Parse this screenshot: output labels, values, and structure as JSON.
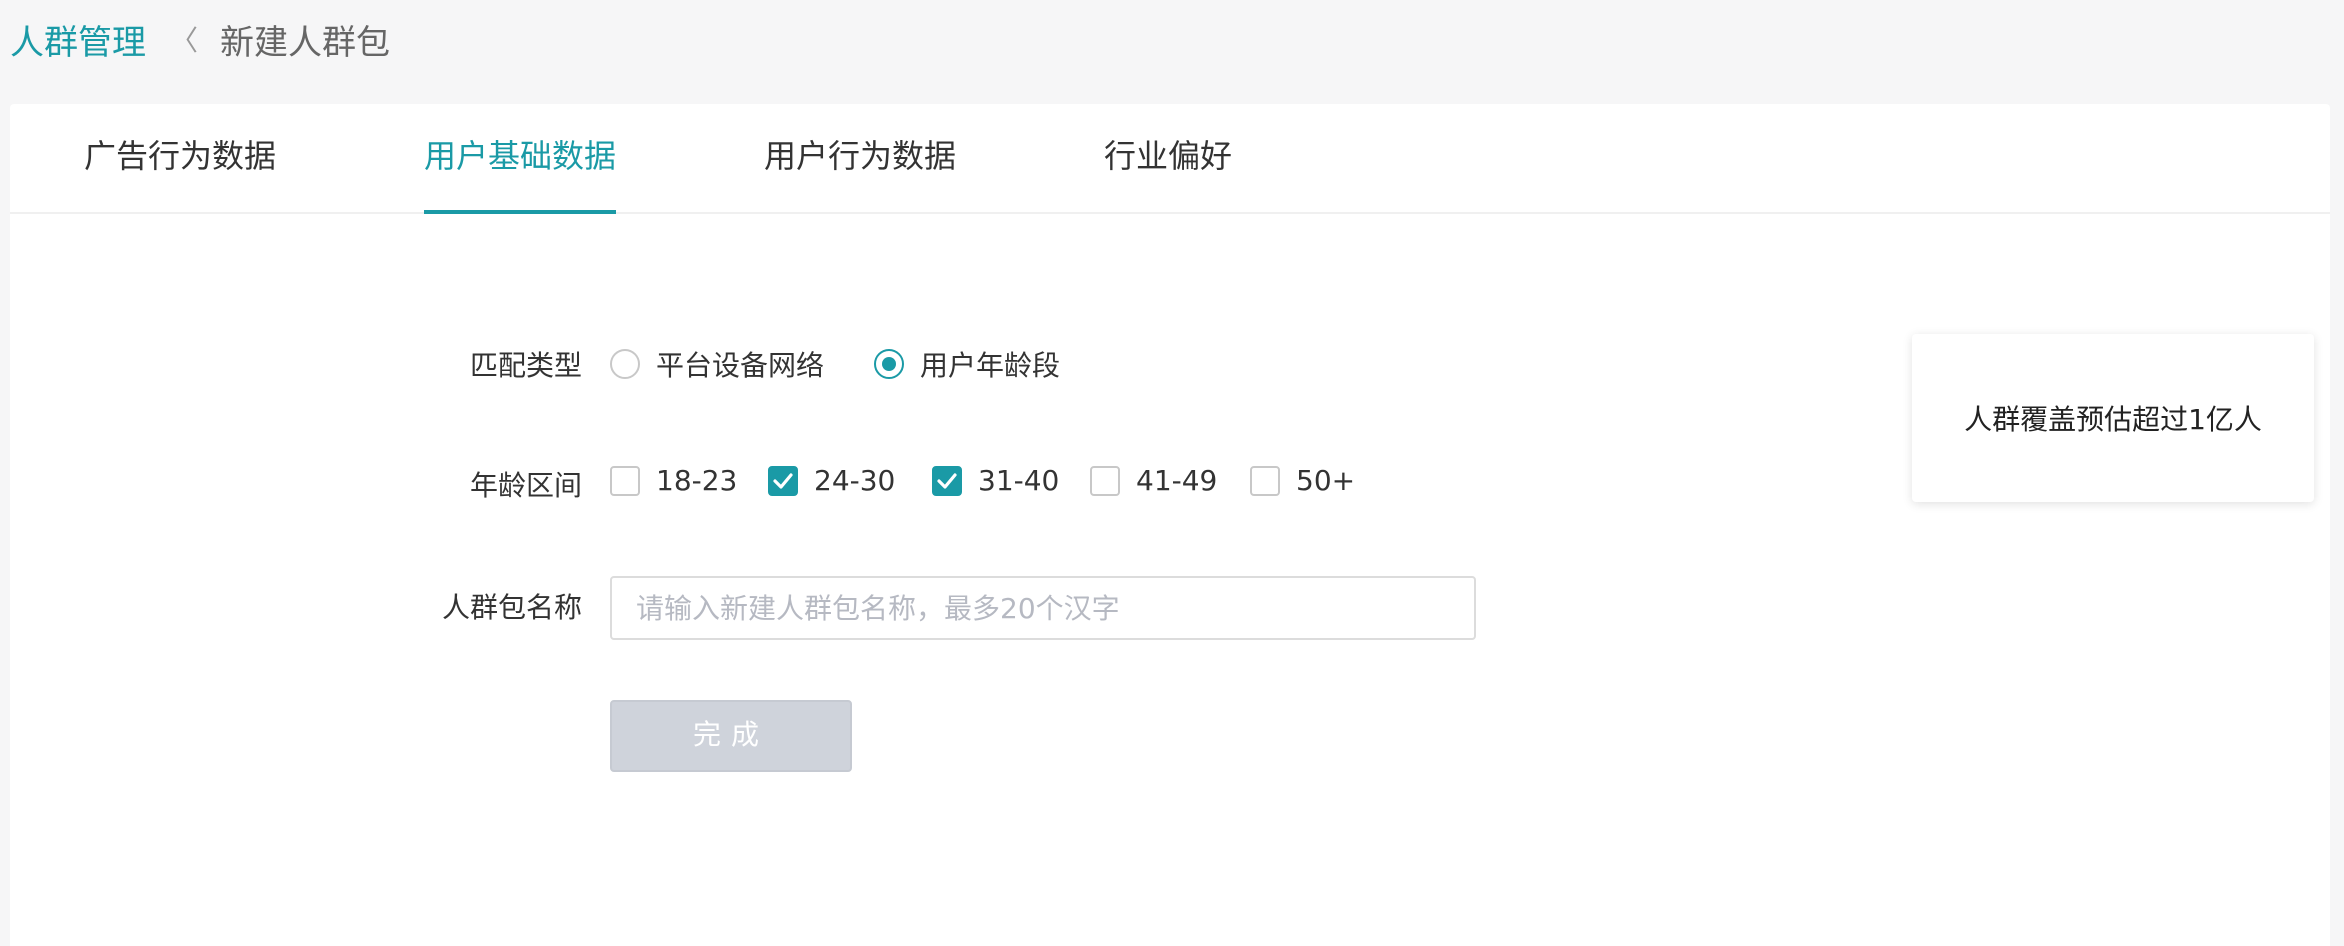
{
  "breadcrumb": {
    "root": "人群管理",
    "separator": "〈",
    "current": "新建人群包"
  },
  "tabs": [
    {
      "label": "广告行为数据",
      "active": false
    },
    {
      "label": "用户基础数据",
      "active": true
    },
    {
      "label": "用户行为数据",
      "active": false
    },
    {
      "label": "行业偏好",
      "active": false
    }
  ],
  "form": {
    "match_type": {
      "label": "匹配类型",
      "options": [
        {
          "label": "平台设备网络",
          "checked": false
        },
        {
          "label": "用户年龄段",
          "checked": true
        }
      ]
    },
    "age_range": {
      "label": "年龄区间",
      "options": [
        {
          "label": "18-23",
          "checked": false
        },
        {
          "label": "24-30",
          "checked": true
        },
        {
          "label": "31-40",
          "checked": true
        },
        {
          "label": "41-49",
          "checked": false
        },
        {
          "label": "50+",
          "checked": false
        }
      ]
    },
    "name": {
      "label": "人群包名称",
      "value": "",
      "placeholder": "请输入新建人群包名称，最多20个汉字"
    },
    "submit_label": "完成"
  },
  "estimate": {
    "text": "人群覆盖预估超过1亿人"
  },
  "colors": {
    "accent": "#1a9aa6",
    "disabled_button": "#cfd3db",
    "page_background": "#f6f6f7"
  }
}
